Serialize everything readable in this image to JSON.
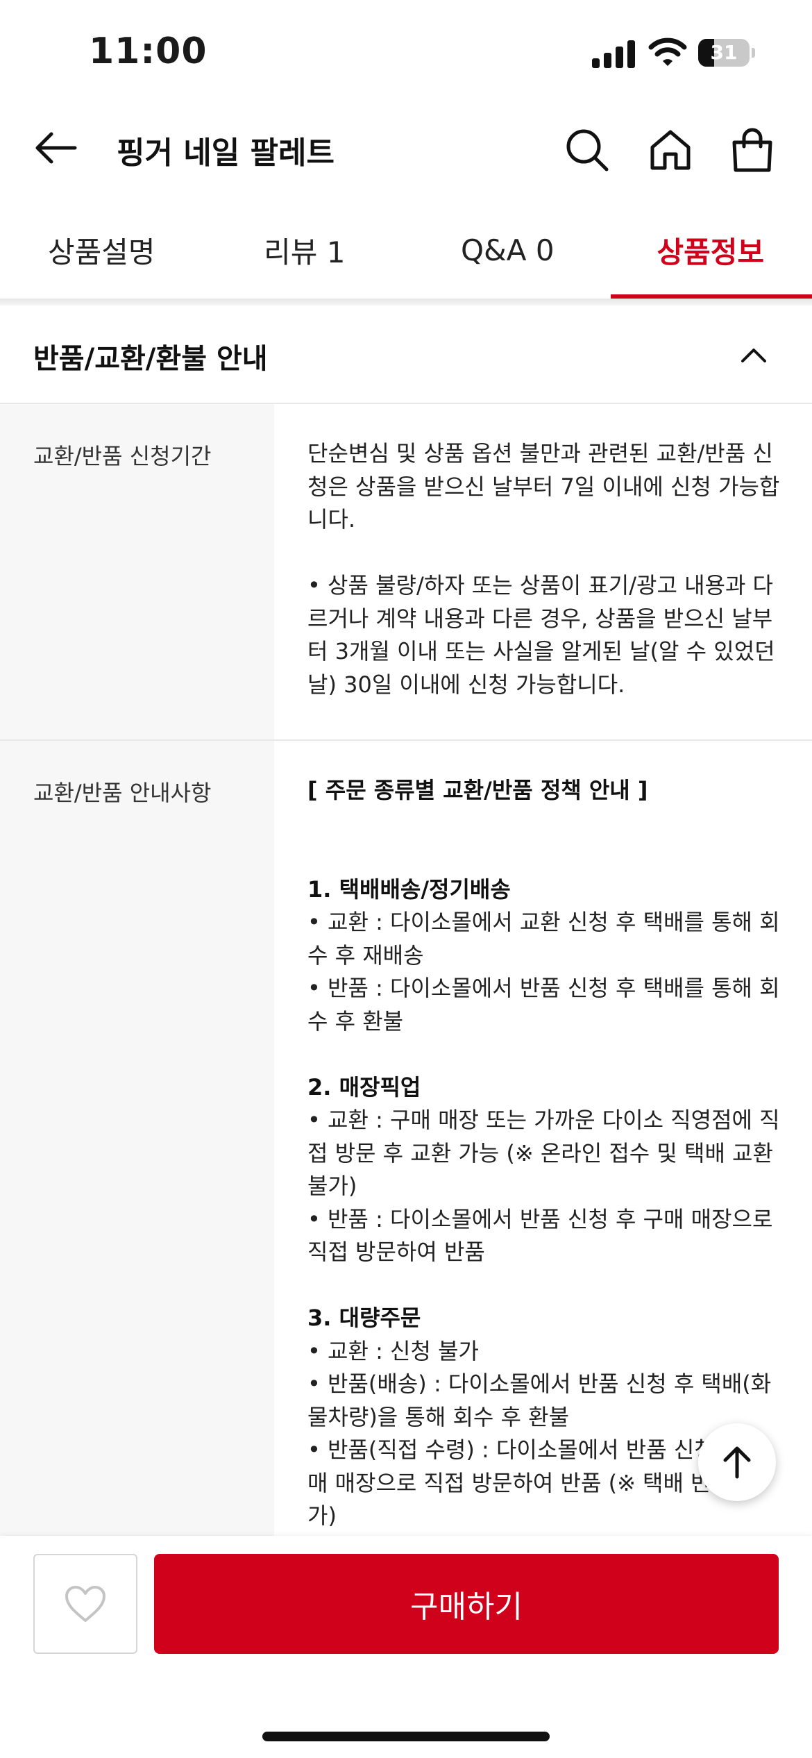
{
  "status_bar": {
    "time": "11:00",
    "battery": "31",
    "battery_level": 0.31,
    "icons": [
      "signal-icon",
      "wifi-icon",
      "battery-icon"
    ]
  },
  "header": {
    "title": "핑거 네일 팔레트",
    "icons": [
      "back-arrow-icon",
      "search-icon",
      "home-icon",
      "shopping-bag-icon"
    ]
  },
  "tabs": [
    {
      "label": "상품설명",
      "active": false
    },
    {
      "label": "리뷰 1",
      "active": false
    },
    {
      "label": "Q&A 0",
      "active": false
    },
    {
      "label": "상품정보",
      "active": true
    }
  ],
  "section": {
    "title": "반품/교환/환불 안내",
    "icon": "chevron-up-icon"
  },
  "rows": [
    {
      "label": "교환/반품 신청기간",
      "value": "단순변심 및 상품 옵션 불만과 관련된 교환/반품 신청은 상품을 받으신 날부터 7일 이내에 신청 가능합니다.\n\n• 상품 불량/하자 또는 상품이 표기/광고 내용과 다르거나 계약 내용과 다른 경우, 상품을 받으신 날부터 3개월 이내 또는 사실을 알게된 날(알 수 있었던 날) 30일 이내에 신청 가능합니다."
    },
    {
      "label": "교환/반품 안내사항",
      "intro": "[ 주문 종류별 교환/반품 정책 안내 ]",
      "h1": "1. 택배배송/정기배송",
      "b1": "• 교환 : 다이소몰에서 교환 신청 후 택배를 통해 회수 후 재배송\n• 반품 : 다이소몰에서 반품 신청 후 택배를 통해 회수 후 환불",
      "h2": "2. 매장픽업",
      "b2": "• 교환 : 구매 매장 또는 가까운 다이소 직영점에 직접 방문 후 교환 가능 (※ 온라인 접수 및 택배 교환 불가)\n• 반품 : 다이소몰에서 반품 신청 후 구매 매장으로 직접 방문하여 반품",
      "h3": "3. 대량주문",
      "b3": "• 교환 : 신청 불가\n• 반품(배송) : 다이소몰에서 반품 신청 후 택배(화물차량)을 통해 회수 후 환불\n• 반품(직접 수령) : 다이소몰에서 반품 신청 후 구매 매장으로 직접 방문하여 반품 (※ 택배 반품 불가)\n• 상품 부족으로 인해 교환 재배송이 불가능할"
    }
  ],
  "bottom_bar": {
    "wish_icon": "heart-icon",
    "buy_label": "구매하기"
  },
  "scroll_top_icon": "arrow-up-icon",
  "colors": {
    "accent": "#d0021b",
    "label_bg": "#f7f7f7",
    "divider": "#e8e8e8"
  }
}
